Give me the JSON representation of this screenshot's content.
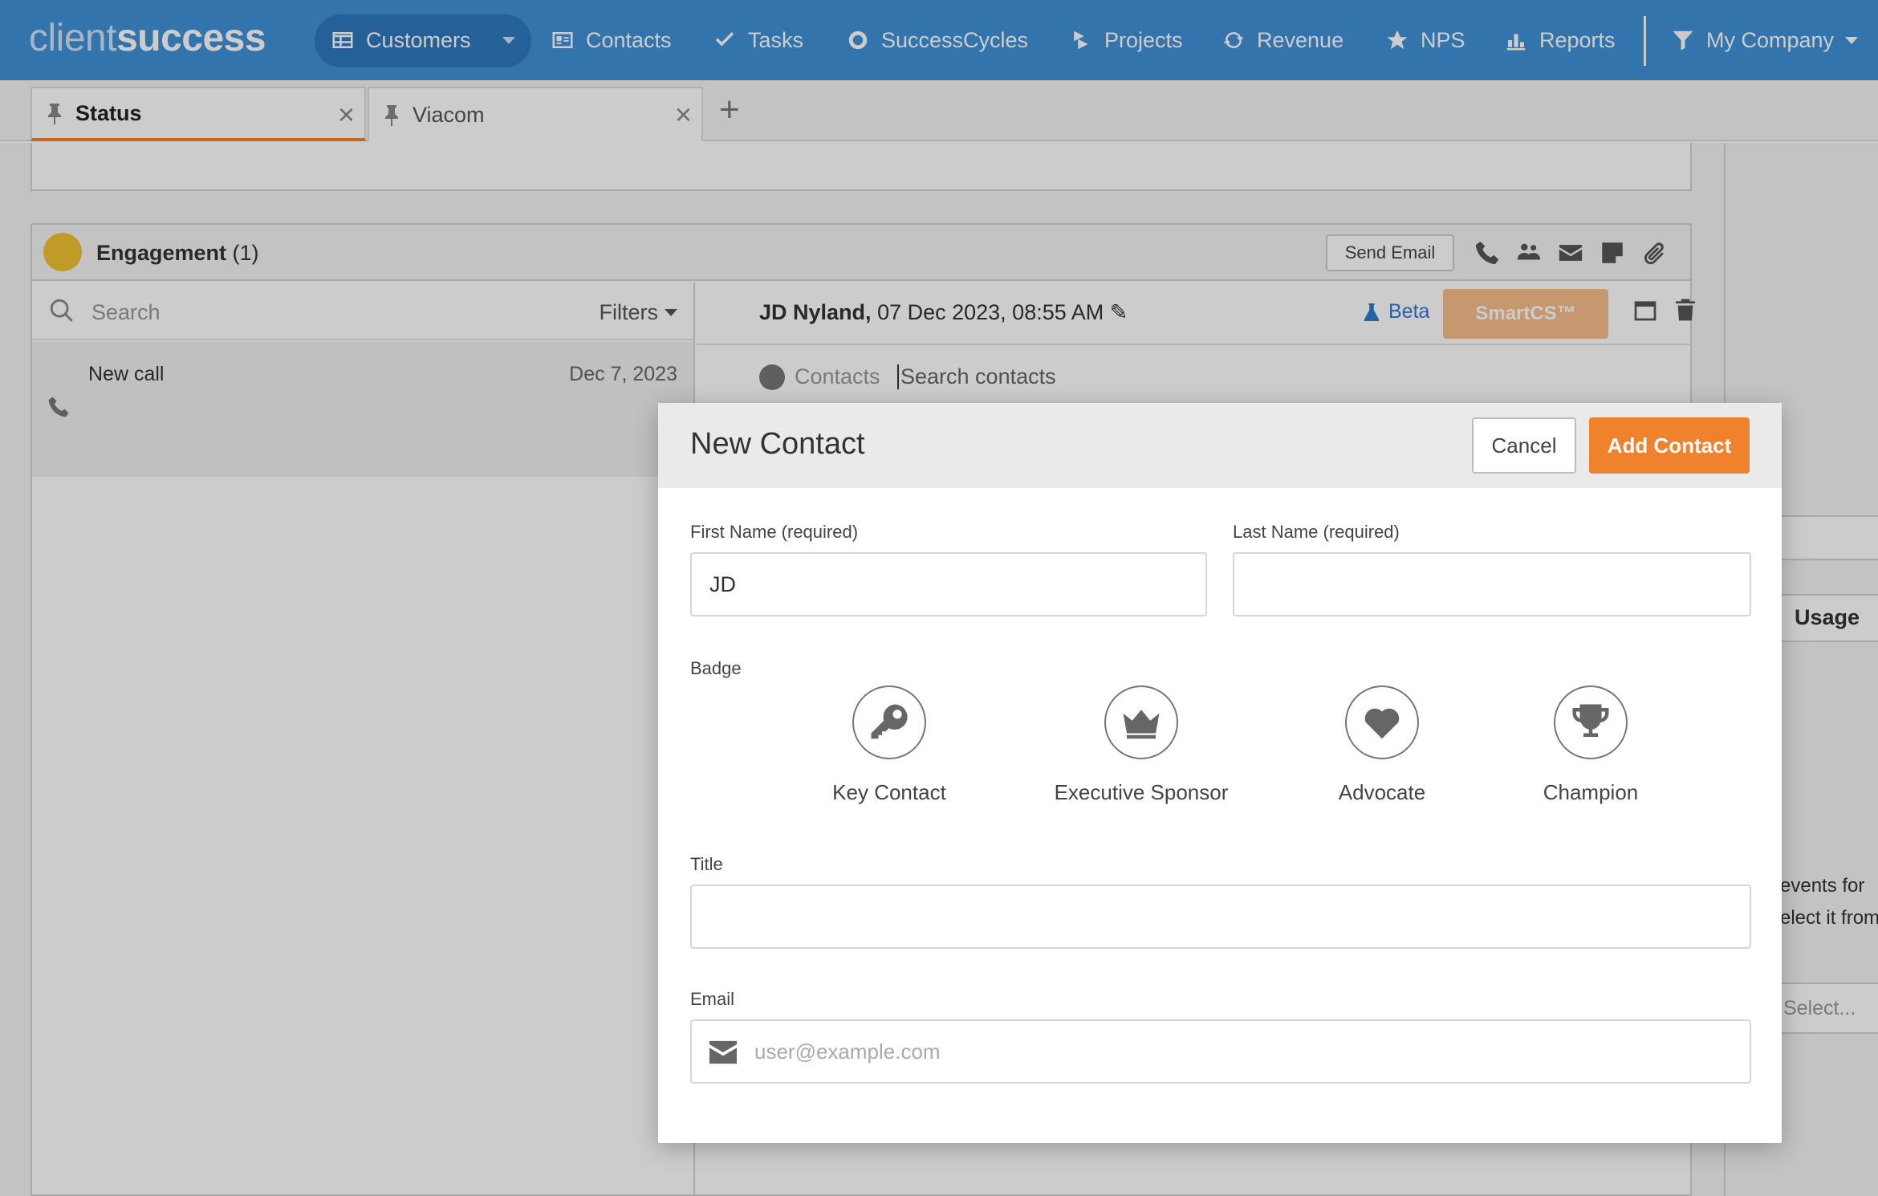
{
  "app": {
    "logo_light": "client",
    "logo_bold": "success"
  },
  "nav": {
    "items": [
      {
        "label": "Customers",
        "icon": "table-icon"
      },
      {
        "label": "Contacts",
        "icon": "contact-card-icon"
      },
      {
        "label": "Tasks",
        "icon": "checkmark-icon"
      },
      {
        "label": "SuccessCycles",
        "icon": "cycle-icon"
      },
      {
        "label": "Projects",
        "icon": "projects-icon"
      },
      {
        "label": "Revenue",
        "icon": "refresh-icon"
      },
      {
        "label": "NPS",
        "icon": "star-icon"
      },
      {
        "label": "Reports",
        "icon": "bar-chart-icon"
      }
    ],
    "company": "My Company"
  },
  "tabs": [
    {
      "label": "Status",
      "active": true
    },
    {
      "label": "Viacom",
      "active": false
    }
  ],
  "engagement": {
    "title": "Engagement",
    "count": "(1)",
    "send_email": "Send Email",
    "search_placeholder": "Search",
    "filters": "Filters",
    "list": [
      {
        "title": "New call",
        "date": "Dec 7, 2023"
      }
    ],
    "detail": {
      "author": "JD Nyland,",
      "datetime": "07 Dec 2023, 08:55 AM",
      "beta": "Beta",
      "smartcs": "SmartCS™",
      "contacts_label": "Contacts",
      "contacts_placeholder": "Search contacts"
    }
  },
  "right_panel": {
    "usage": "Usage",
    "line1": "events for",
    "line2": "elect it from",
    "select": "Select..."
  },
  "modal": {
    "title": "New Contact",
    "cancel": "Cancel",
    "add": "Add Contact",
    "first_name_label": "First Name (required)",
    "first_name_value": "JD",
    "last_name_label": "Last Name (required)",
    "last_name_value": "",
    "badge_label": "Badge",
    "badges": [
      {
        "label": "Key Contact",
        "icon": "key-icon"
      },
      {
        "label": "Executive Sponsor",
        "icon": "crown-icon"
      },
      {
        "label": "Advocate",
        "icon": "heart-icon"
      },
      {
        "label": "Champion",
        "icon": "trophy-icon"
      }
    ],
    "title_label": "Title",
    "title_value": "",
    "email_label": "Email",
    "email_placeholder": "user@example.com",
    "email_value": ""
  },
  "colors": {
    "nav_bg": "#4191d9",
    "accent": "#f0822e",
    "link": "#2b7bd0"
  }
}
